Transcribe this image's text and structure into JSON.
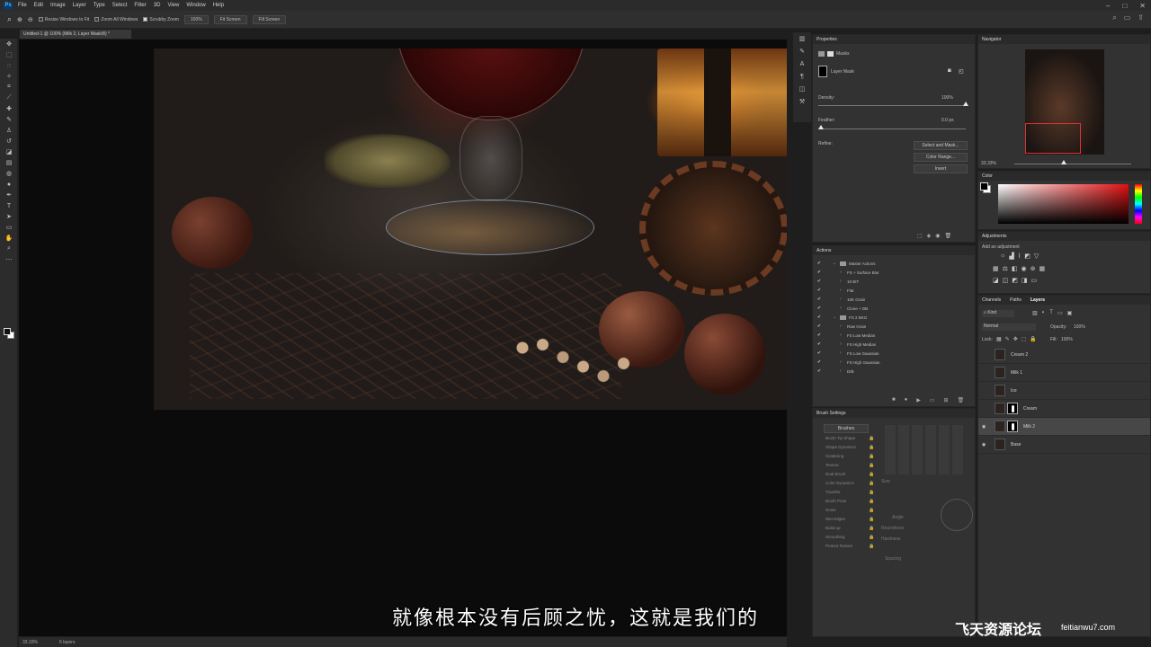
{
  "app": {
    "logo": "Ps"
  },
  "menu": [
    "File",
    "Edit",
    "Image",
    "Layer",
    "Type",
    "Select",
    "Filter",
    "3D",
    "View",
    "Window",
    "Help"
  ],
  "window_controls": [
    "–",
    "□",
    "✕"
  ],
  "options_bar": {
    "resize_windows": "Resize Windows to Fit",
    "zoom_all_windows": "Zoom All Windows",
    "scrubby_zoom": "Scrubby Zoom",
    "zoom_value": "100%",
    "fit_screen": "Fit Screen",
    "fill_screen": "Fill Screen"
  },
  "document_tab": "Untitled-1 @ 100% (Milk 2, Layer Mask/8) *",
  "status_bar": {
    "zoom": "33.33%",
    "info": "6 layers"
  },
  "subtitle": "就像根本没有后顾之忧，这就是我们的",
  "watermark": {
    "text": "飞天资源论坛",
    "url": "feitianwu7.com"
  },
  "properties": {
    "title": "Properties",
    "masks_label": "Masks",
    "layer_mask_label": "Layer Mask",
    "density_label": "Density:",
    "density_value": "100%",
    "density_level": 1.0,
    "feather_label": "Feather:",
    "feather_value": "0.0 px",
    "feather_level": 0.0,
    "refine_label": "Refine:",
    "buttons": [
      "Select and Mask...",
      "Color Range...",
      "Invert"
    ]
  },
  "actions": {
    "title": "Actions",
    "items": [
      {
        "label": "Master Actions",
        "level": 0,
        "folder": true
      },
      {
        "label": "FS + Surface Blur",
        "level": 1
      },
      {
        "label": "10 BIT",
        "level": 1
      },
      {
        "label": "Flat",
        "level": 1
      },
      {
        "label": "10K Grain",
        "level": 1
      },
      {
        "label": "Clone + DB",
        "level": 1
      },
      {
        "label": "FS 2 BKG",
        "level": 0,
        "folder": true
      },
      {
        "label": "Raw Grain",
        "level": 1
      },
      {
        "label": "FS Low Median",
        "level": 1
      },
      {
        "label": "FS High Median",
        "level": 1
      },
      {
        "label": "FS Low Gaussian",
        "level": 1
      },
      {
        "label": "FS High Gaussian",
        "level": 1
      },
      {
        "label": "D/B",
        "level": 1
      }
    ]
  },
  "brush_settings": {
    "title": "Brush Settings",
    "brushes_btn": "Brushes",
    "items": [
      "Brush Tip Shape",
      "Shape Dynamics",
      "Scattering",
      "Texture",
      "Dual Brush",
      "Color Dynamics",
      "Transfer",
      "Brush Pose",
      "Noise",
      "Wet Edges",
      "Build-up",
      "Smoothing",
      "Protect Texture"
    ],
    "size_label": "Size",
    "angle_label": "Angle",
    "roundness_label": "Roundness",
    "hardness_label": "Hardness",
    "spacing_label": "Spacing"
  },
  "navigator": {
    "title": "Navigator",
    "zoom": "33.33%"
  },
  "color": {
    "title": "Color"
  },
  "adjustments": {
    "title": "Adjustments",
    "subtitle": "Add an adjustment"
  },
  "layers": {
    "tabs": [
      "Channels",
      "Paths",
      "Layers"
    ],
    "kind": "Kind",
    "blend_mode": "Normal",
    "opacity_label": "Opacity:",
    "opacity_value": "100%",
    "lock_label": "Lock:",
    "fill_label": "Fill:",
    "fill_value": "100%",
    "items": [
      {
        "name": "Cream 2",
        "visible": false,
        "mask": false,
        "selected": false
      },
      {
        "name": "Milk 1",
        "visible": false,
        "mask": false,
        "selected": false
      },
      {
        "name": "Ice",
        "visible": false,
        "mask": false,
        "selected": false
      },
      {
        "name": "Cream",
        "visible": false,
        "mask": true,
        "selected": false
      },
      {
        "name": "Milk 2",
        "visible": true,
        "mask": true,
        "selected": true
      },
      {
        "name": "Base",
        "visible": true,
        "mask": false,
        "selected": false
      }
    ]
  },
  "colors": {
    "accent": "#31a8ff",
    "panel": "#323232",
    "selected": "#474747"
  }
}
